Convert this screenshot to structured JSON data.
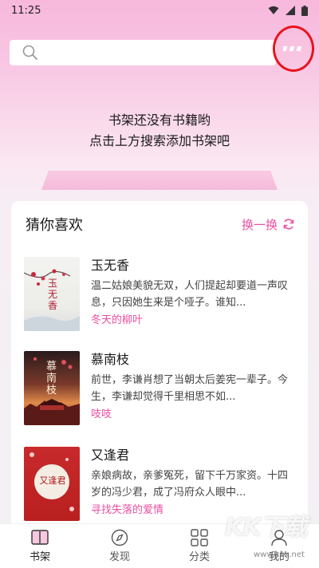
{
  "status": {
    "time": "11:25"
  },
  "search": {
    "placeholder": ""
  },
  "empty": {
    "line1": "书架还没有书籍哟",
    "line2": "点击上方搜索添加书架吧"
  },
  "recommend": {
    "title": "猜你喜欢",
    "refresh_label": "换一换",
    "books": [
      {
        "title": "玉无香",
        "desc": "温二姑娘美貌无双，人们提起却要道一声叹息，只因她生来是个哑子。谁知...",
        "author": "冬天的柳叶",
        "cover_text": "玉无香"
      },
      {
        "title": "慕南枝",
        "desc": "前世，李谦肖想了当朝太后姜宪一辈子。今生，李谦却觉得千里相思不如...",
        "author": "吱吱",
        "cover_text": "慕南枝"
      },
      {
        "title": "又逢君",
        "desc": "亲娘病故，亲爹冤死，留下千万家资。十四岁的冯少君，成了冯府众人眼中...",
        "author": "寻找失落的爱情",
        "cover_text": "又逢君"
      }
    ]
  },
  "tabs": [
    {
      "label": "书架",
      "icon": "book-icon"
    },
    {
      "label": "发现",
      "icon": "compass-icon"
    },
    {
      "label": "分类",
      "icon": "grid-icon"
    },
    {
      "label": "我的",
      "icon": "user-icon"
    }
  ],
  "watermark": {
    "text": "KK下载",
    "subtext": "www.kkx.net"
  },
  "colors": {
    "accent": "#ea4fa0",
    "highlight_ring": "#e8141c"
  }
}
